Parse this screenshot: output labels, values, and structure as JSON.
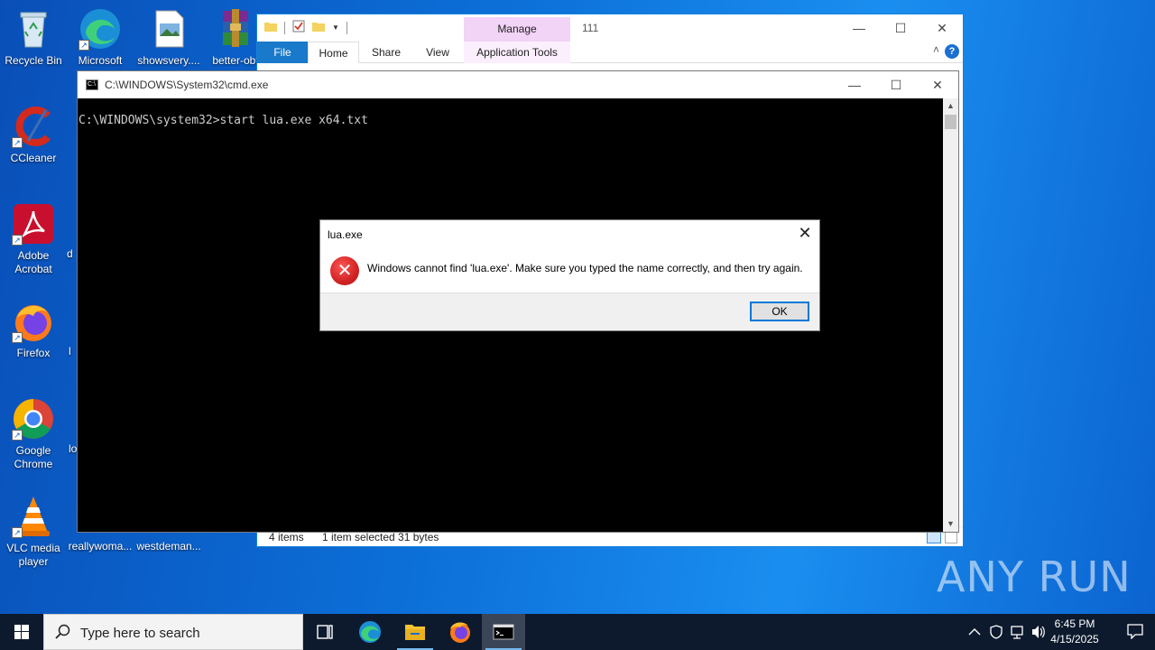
{
  "desktop": {
    "icons": [
      {
        "label": "Recycle Bin"
      },
      {
        "label": "Microsoft Edge"
      },
      {
        "label": "showsvery...."
      },
      {
        "label": "better-obf"
      },
      {
        "label": "CCleaner"
      },
      {
        "label": "Adobe Acrobat"
      },
      {
        "label": "Firefox"
      },
      {
        "label": "Google Chrome"
      },
      {
        "label": "VLC media player"
      },
      {
        "label": "reallywoma..."
      },
      {
        "label": "westdeman..."
      },
      {
        "label": "d"
      },
      {
        "label": "l"
      },
      {
        "label": "lo"
      }
    ]
  },
  "explorer": {
    "title": "111",
    "manage_label": "Manage",
    "tabs": {
      "file": "File",
      "home": "Home",
      "share": "Share",
      "view": "View",
      "apptools": "Application Tools"
    },
    "help_label": "?",
    "status": {
      "items": "4 items",
      "selected": "1 item selected  31 bytes"
    }
  },
  "cmd": {
    "title": "C:\\WINDOWS\\System32\\cmd.exe",
    "line": "C:\\WINDOWS\\system32>start lua.exe x64.txt"
  },
  "dialog": {
    "title": "lua.exe",
    "message": "Windows cannot find 'lua.exe'. Make sure you typed the name correctly, and then try again.",
    "ok_label": "OK"
  },
  "watermark": "ANY RUN",
  "taskbar": {
    "search_placeholder": "Type here to search",
    "time": "6:45 PM",
    "date": "4/15/2025"
  },
  "colors": {
    "accent": "#0078d7",
    "error": "#d12323",
    "taskbar": "#0d1a2e"
  }
}
